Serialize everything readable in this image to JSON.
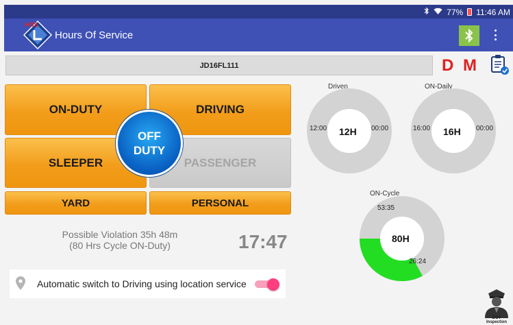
{
  "statusbar": {
    "bluetooth_icon": "bluetooth-icon",
    "wifi_icon": "wifi-icon",
    "battery": "77%",
    "time": "11:46 AM"
  },
  "appbar": {
    "logo_text": "HOS",
    "title": "Hours Of Service",
    "bluetooth_button_icon": "bluetooth-icon",
    "menu_icon": "more-vert-icon"
  },
  "vehicle": {
    "id": "JD16FL111"
  },
  "flags": {
    "d": "D",
    "m": "M"
  },
  "duty_buttons": {
    "on_duty": "ON-DUTY",
    "driving": "DRIVING",
    "sleeper": "SLEEPER",
    "passenger": "PASSENGER",
    "yard": "YARD",
    "personal": "PERSONAL",
    "off_duty_line1": "OFF",
    "off_duty_line2": "DUTY"
  },
  "violation": {
    "line1": "Possible Violation 35h 48m",
    "line2": "(80 Hrs Cycle ON-Duty)",
    "clock": "17:47"
  },
  "auto_switch": {
    "label": "Automatic switch to Driving using location service",
    "enabled": true
  },
  "gauges": {
    "driven": {
      "label": "Driven",
      "center": "12H",
      "left": "12:00",
      "right": "00:00",
      "used_fraction": 0
    },
    "on_daily": {
      "label": "ON-Daily",
      "center": "16H",
      "left": "16:00",
      "right": "00:00",
      "used_fraction": 0
    },
    "on_cycle": {
      "label": "ON-Cycle",
      "center": "80H",
      "remaining": "53:35",
      "used": "26:24",
      "used_fraction": 0.33
    }
  },
  "colors": {
    "appbar": "#3f51b5",
    "statusbar": "#2c3a8a",
    "duty_orange": "#f5a623",
    "off_duty_blue": "#0a62c4",
    "gauge_gray": "#d3d3d3",
    "gauge_used": "#22dd22",
    "flag_red": "#e02020",
    "toggle_pink": "#ff3e7f"
  },
  "dot_inspection": {
    "label": "DOT Inspection"
  }
}
